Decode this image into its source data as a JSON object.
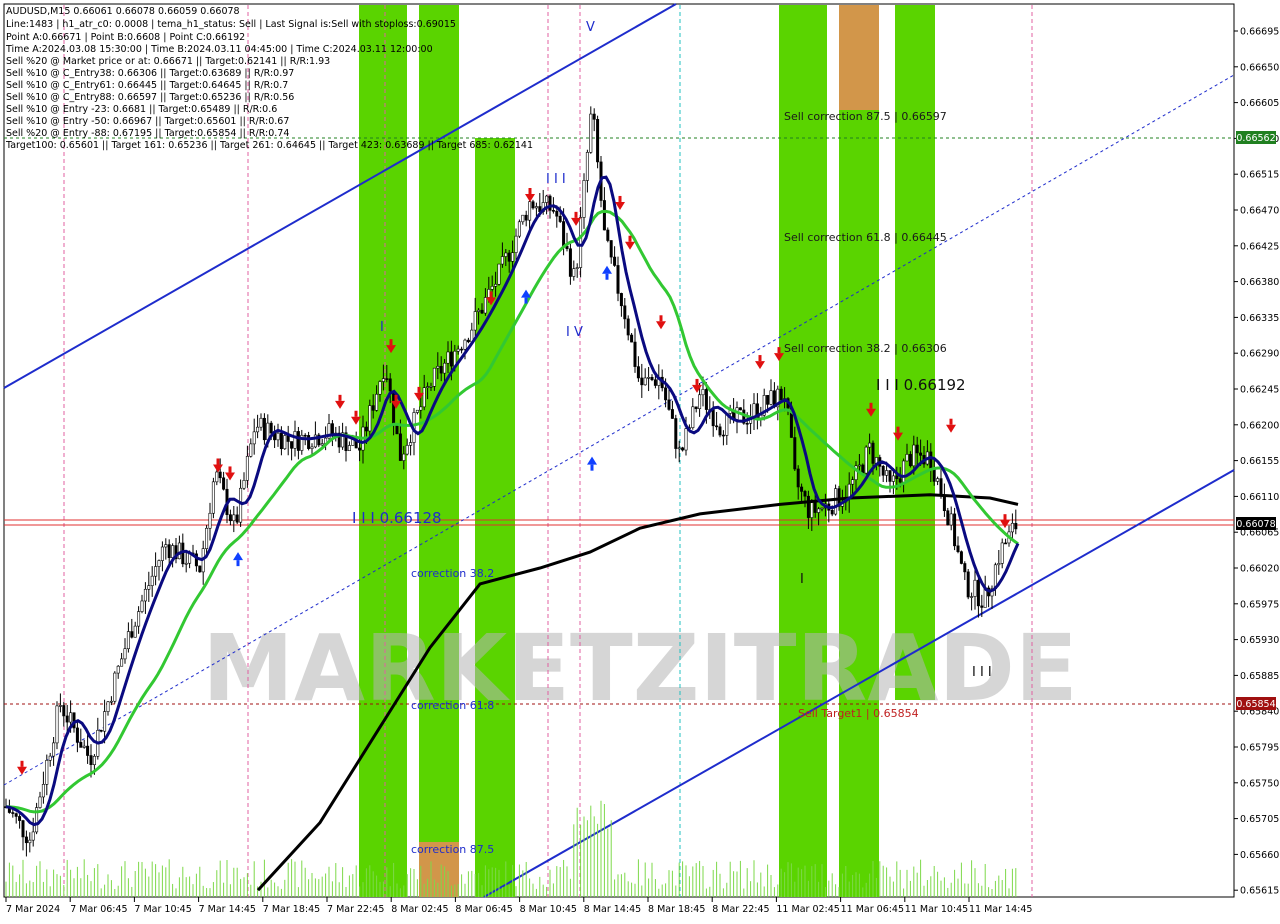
{
  "chart_data": {
    "type": "candlestick",
    "symbol_line": "AUDUSD,M15  0.66061 0.66078 0.66059 0.66078",
    "info_lines": [
      "Line:1483 | h1_atr_c0: 0.0008 | tema_h1_status: Sell | Last Signal is:Sell with stoploss:0.69015",
      "Point A:0.66671 | Point B:0.6608 | Point C:0.66192",
      "Time A:2024.03.08 15:30:00 | Time B:2024.03.11 04:45:00 | Time C:2024.03.11 12:00:00",
      "Sell %20 @ Market price or at: 0.66671 || Target:0.62141 || R/R:1.93",
      "Sell %10 @ C_Entry38: 0.66306 || Target:0.63689 || R/R:0.97",
      "Sell %10 @ C_Entry61: 0.66445 || Target:0.64645 || R/R:0.7",
      "Sell %10 @ C_Entry88: 0.66597 || Target:0.65236 || R/R:0.56",
      "Sell %10 @ Entry -23: 0.6681 || Target:0.65489 || R/R:0.6",
      "Sell %10 @ Entry -50: 0.66967 || Target:0.65601 || R/R:0.67",
      "Sell %20 @ Entry -88: 0.67195 || Target:0.65854 || R/R:0.74",
      "Target100: 0.65601 || Target 161: 0.65236 || Target 261: 0.64645 || Target 423: 0.63689 || Target 685: 0.62141"
    ],
    "y_ticks": [
      "0.66695",
      "0.66650",
      "0.66605",
      "0.66560",
      "0.66515",
      "0.66470",
      "0.66425",
      "0.66380",
      "0.66335",
      "0.66290",
      "0.66245",
      "0.66200",
      "0.66155",
      "0.66110",
      "0.66065",
      "0.66020",
      "0.65975",
      "0.65930",
      "0.65885",
      "0.65840",
      "0.65795",
      "0.65750",
      "0.65705",
      "0.65660",
      "0.65615"
    ],
    "x_ticks": [
      "7 Mar 2024",
      "7 Mar 06:45",
      "7 Mar 10:45",
      "7 Mar 14:45",
      "7 Mar 18:45",
      "7 Mar 22:45",
      "8 Mar 02:45",
      "8 Mar 06:45",
      "8 Mar 10:45",
      "8 Mar 14:45",
      "8 Mar 18:45",
      "8 Mar 22:45",
      "11 Mar 02:45",
      "11 Mar 06:45",
      "11 Mar 10:45",
      "11 Mar 14:45"
    ],
    "price_badges": {
      "level_green": "0.66562",
      "current": "0.66078",
      "target": "0.65854"
    },
    "annotations": {
      "sell_correction_875": "Sell correction 87.5 | 0.66597",
      "sell_correction_618": "Sell correction 61.8 | 0.66445",
      "sell_correction_382": "Sell correction 38.2 | 0.66306",
      "point_c_label": "I I I 0.66192",
      "point_b_label": "I I I 0.66128",
      "correction_382": "correction 38.2",
      "correction_618": "correction 61.8",
      "correction_875": "correction 87.5",
      "sell_target": "Sell Target1 | 0.65854",
      "wave_3": "I I I",
      "wave_1": "I",
      "wave_5": "V",
      "wave_4": "I V",
      "wave_1b": "I",
      "wave_3b": "I I I"
    },
    "watermark": "MARKETZITRADE",
    "colors": {
      "bull_band": "#5ad400",
      "orange_band": "#d2964a",
      "ma_fast": "#0a0a80",
      "ma_mid": "#32c832",
      "ma_slow": "#000000",
      "channel": "#1e2ccc",
      "sell_arrow": "#e01010",
      "buy_arrow": "#1040ff",
      "price_line": "#e03030"
    }
  }
}
